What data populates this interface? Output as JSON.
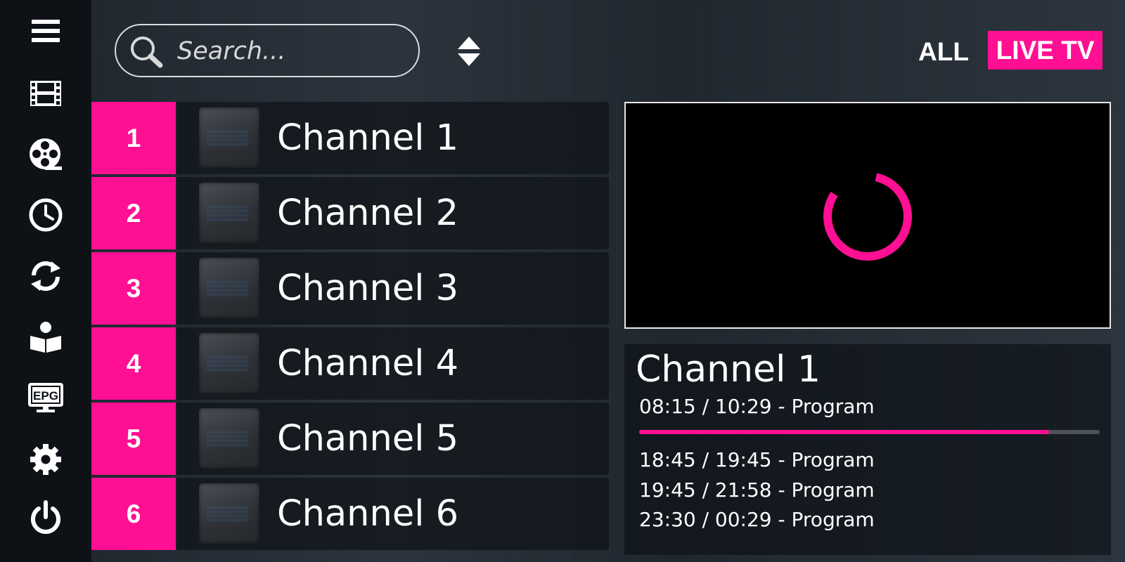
{
  "search": {
    "placeholder": "Search..."
  },
  "filters": {
    "all": "ALL",
    "live": "LIVE TV"
  },
  "colors": {
    "accent": "#ff0f92",
    "sidebar": "#0e1217"
  },
  "sidebar": {
    "items": [
      {
        "name": "menu",
        "icon": "hamburger-menu-icon"
      },
      {
        "name": "movies",
        "icon": "film-strip-icon"
      },
      {
        "name": "series",
        "icon": "film-reel-icon"
      },
      {
        "name": "catch-up",
        "icon": "clock-icon"
      },
      {
        "name": "refresh",
        "icon": "sync-icon"
      },
      {
        "name": "guide",
        "icon": "reader-icon"
      },
      {
        "name": "epg",
        "icon": "epg-monitor-icon",
        "label": "EPG"
      },
      {
        "name": "settings",
        "icon": "gear-icon"
      },
      {
        "name": "power",
        "icon": "power-icon"
      }
    ]
  },
  "channels": [
    {
      "number": "1",
      "name": "Channel 1"
    },
    {
      "number": "2",
      "name": "Channel 2"
    },
    {
      "number": "3",
      "name": "Channel 3"
    },
    {
      "number": "4",
      "name": "Channel 4"
    },
    {
      "number": "5",
      "name": "Channel 5"
    },
    {
      "number": "6",
      "name": "Channel 6"
    }
  ],
  "player": {
    "state": "loading"
  },
  "now_playing": {
    "channel": "Channel 1",
    "current": "08:15 / 10:29 -  Program",
    "progress": 0.89,
    "upcoming": [
      "18:45 / 19:45 -  Program",
      "19:45 / 21:58 -  Program",
      "23:30 / 00:29 -  Program"
    ]
  }
}
